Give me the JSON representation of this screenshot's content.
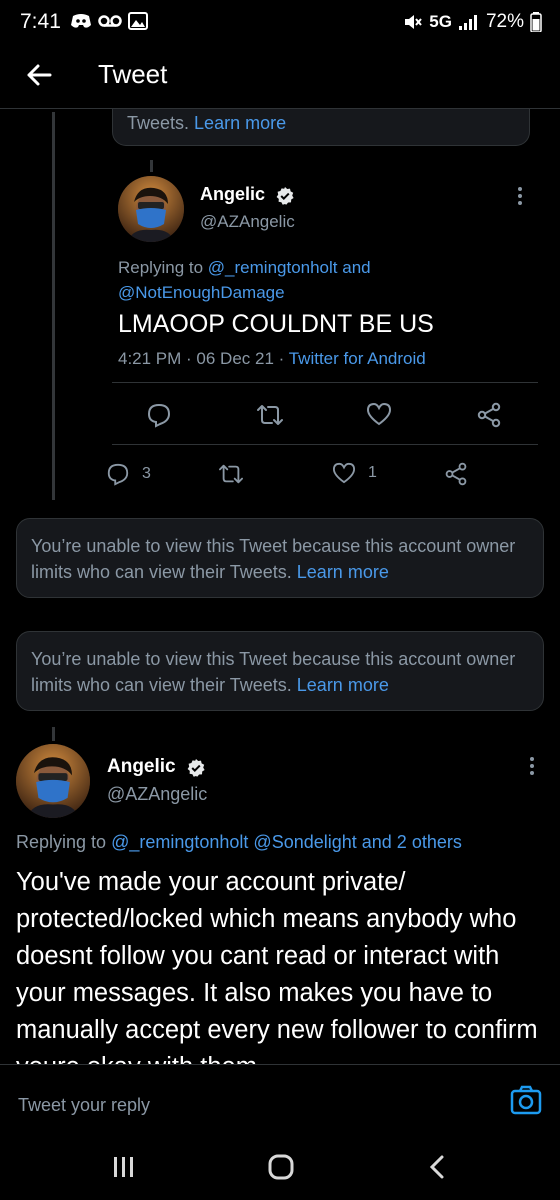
{
  "status": {
    "time": "7:41",
    "network": "5G",
    "battery": "72%"
  },
  "header": {
    "title": "Tweet"
  },
  "top_notice": {
    "text_partial": "Tweets.",
    "learn_more": "Learn more"
  },
  "nested_tweet": {
    "name": "Angelic",
    "handle": "@AZAngelic",
    "replying_prefix": "Replying to",
    "replying_to_1": "@_remingtonholt and",
    "replying_to_2": "@NotEnoughDamage",
    "text": "LMAOOP COULDNT BE US",
    "time": "4:21 PM · 06 Dec 21 ·",
    "source": "Twitter for Android"
  },
  "thread_actions": {
    "reply_count": "3",
    "like_count": "1"
  },
  "notice_1": {
    "text": "You’re unable to view this Tweet because this account owner limits who can view their Tweets.",
    "learn_more": "Learn more"
  },
  "notice_2": {
    "text": "You’re unable to view this Tweet because this account owner limits who can view their Tweets.",
    "learn_more": "Learn more"
  },
  "main_tweet": {
    "name": "Angelic",
    "handle": "@AZAngelic",
    "replying_prefix": "Replying to",
    "replying_to": "@_remingtonholt @Sondelight and 2 others",
    "text": "You've made your account private/ protected/locked which means anybody who doesnt follow you cant read or interact with your messages. It also makes you have to manually accept every new follower to confirm youre okay with them"
  },
  "reply_bar": {
    "placeholder": "Tweet your reply"
  },
  "icons": {
    "back": "arrow-left-icon",
    "verified": "verified-badge-icon",
    "reply": "reply-icon",
    "retweet": "retweet-icon",
    "like": "heart-icon",
    "share": "share-icon",
    "camera": "camera-icon",
    "more": "more-vertical-icon"
  },
  "colors": {
    "accent": "#1d9bf0",
    "background": "#000000",
    "card": "#16181c",
    "muted": "#8b98a5"
  }
}
